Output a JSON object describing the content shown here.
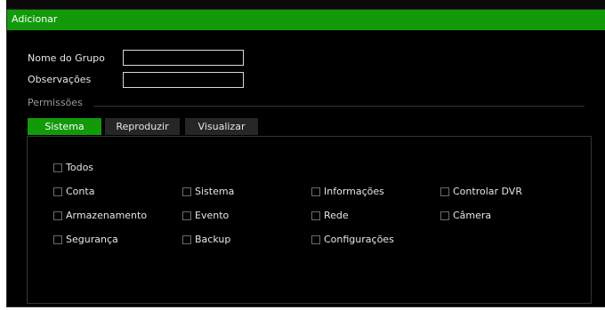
{
  "window": {
    "title": "Adicionar"
  },
  "form": {
    "group_name_label": "Nome do Grupo",
    "group_name_value": "",
    "notes_label": "Observações",
    "notes_value": ""
  },
  "permissions": {
    "section_label": "Permissões",
    "tabs": [
      {
        "label": "Sistema",
        "active": true
      },
      {
        "label": "Reproduzir",
        "active": false
      },
      {
        "label": "Visualizar",
        "active": false
      }
    ],
    "all_label": "Todos",
    "items": [
      {
        "label": "Conta",
        "checked": false
      },
      {
        "label": "Sistema",
        "checked": false
      },
      {
        "label": "Informações",
        "checked": false
      },
      {
        "label": "Controlar DVR",
        "checked": false
      },
      {
        "label": "Armazenamento",
        "checked": false
      },
      {
        "label": "Evento",
        "checked": false
      },
      {
        "label": "Rede",
        "checked": false
      },
      {
        "label": "Câmera",
        "checked": false
      },
      {
        "label": "Segurança",
        "checked": false
      },
      {
        "label": "Backup",
        "checked": false
      },
      {
        "label": "Configurações",
        "checked": false
      }
    ]
  },
  "colors": {
    "accent": "#129a0a",
    "background": "#000000",
    "tab_inactive": "#262626"
  }
}
